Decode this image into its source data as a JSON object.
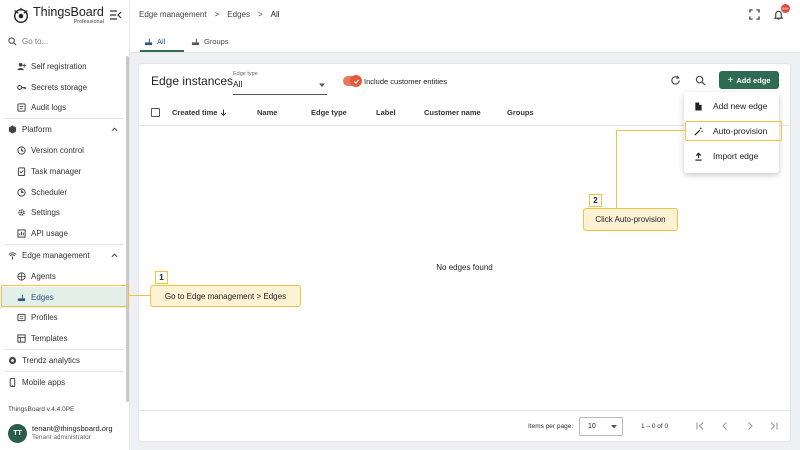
{
  "app": {
    "brand": "ThingsBoard",
    "edition": "Professional",
    "version": "ThingsBoard v.4.4.0PE"
  },
  "search": {
    "placeholder": "Go to..."
  },
  "sidebar": {
    "items": [
      {
        "label": "Self registration",
        "icon": "person-add-icon"
      },
      {
        "label": "Secrets storage",
        "icon": "key-icon"
      },
      {
        "label": "Audit logs",
        "icon": "audit-log-icon"
      },
      {
        "label": "Platform",
        "icon": "platform-icon",
        "expanded": true
      },
      {
        "label": "Version control",
        "icon": "history-icon"
      },
      {
        "label": "Task manager",
        "icon": "task-icon"
      },
      {
        "label": "Scheduler",
        "icon": "clock-icon"
      },
      {
        "label": "Settings",
        "icon": "gear-icon"
      },
      {
        "label": "API usage",
        "icon": "api-usage-icon"
      },
      {
        "label": "Edge management",
        "icon": "edge-icon",
        "expanded": true
      },
      {
        "label": "Agents",
        "icon": "agent-icon"
      },
      {
        "label": "Edges",
        "icon": "router-icon",
        "active": true
      },
      {
        "label": "Profiles",
        "icon": "profile-icon"
      },
      {
        "label": "Templates",
        "icon": "template-icon"
      },
      {
        "label": "Trendz analytics",
        "icon": "trendz-icon"
      },
      {
        "label": "Mobile apps",
        "icon": "mobile-icon"
      }
    ]
  },
  "user": {
    "initials": "TT",
    "email": "tenant@thingsboard.org",
    "role": "Tenant administrator"
  },
  "breadcrumb": [
    "Edge management",
    ">",
    "Edges",
    ">",
    "All"
  ],
  "notifications": {
    "badge": "99+"
  },
  "tabs": [
    {
      "label": "All",
      "active": true
    },
    {
      "label": "Groups",
      "active": false
    }
  ],
  "card": {
    "title": "Edge instances",
    "edge_type_label": "Edge type",
    "edge_type_value": "All",
    "include_customer_label": "Include customer entities",
    "include_customer_checked": true,
    "add_button": "Add edge"
  },
  "table": {
    "columns": [
      "Created time",
      "Name",
      "Edge type",
      "Label",
      "Customer name",
      "Groups"
    ],
    "empty_text": "No edges found"
  },
  "pager": {
    "items_per_page_label": "Items per page:",
    "items_per_page": "10",
    "range": "1 – 0 of 0"
  },
  "menu": {
    "items": [
      {
        "label": "Add new edge",
        "icon": "file-icon"
      },
      {
        "label": "Auto-provision",
        "icon": "magic-wand-icon"
      },
      {
        "label": "Import edge",
        "icon": "upload-icon"
      }
    ]
  },
  "callouts": {
    "step1_number": "1",
    "step1_text": "Go to Edge management > Edges",
    "step2_number": "2",
    "step2_text": "Click Auto-provision"
  },
  "colors": {
    "accent": "#2f6b53",
    "highlight": "#f1c344",
    "callout_bg": "#fdf2d4",
    "toggle": "#e35b38",
    "badge": "#e04a3a"
  }
}
